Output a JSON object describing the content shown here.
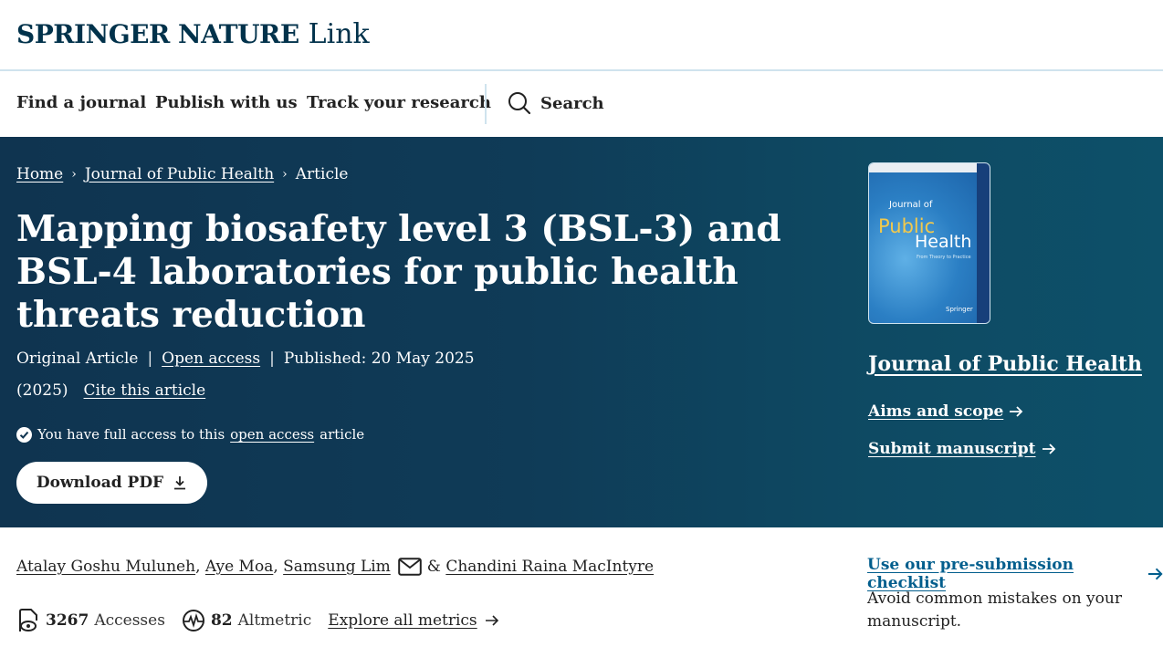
{
  "logo": {
    "brand": "SPRINGER NATURE",
    "product": "Link"
  },
  "nav": {
    "items": [
      "Find a journal",
      "Publish with us",
      "Track your research"
    ],
    "search_label": "Search"
  },
  "breadcrumb": {
    "home": "Home",
    "journal": "Journal of Public Health",
    "current": "Article",
    "separator": "›"
  },
  "article": {
    "title": "Mapping biosafety level 3 (BSL-3) and BSL-4 laboratories for public health threats reduction",
    "type": "Original Article",
    "access_label": "Open access",
    "published": "Published: 20 May 2025",
    "year": "(2025)",
    "cite_label": "Cite this article",
    "access_note_prefix": "You have full access to this",
    "access_note_link": "open access",
    "access_note_suffix": "article",
    "download_label": "Download PDF",
    "separator": "|"
  },
  "cover": {
    "line1": "Journal of",
    "line2": "Public",
    "line3": "Health",
    "subtitle": "From Theory to Practice",
    "publisher": "Springer"
  },
  "sidebar": {
    "journal_title": "Journal of Public Health",
    "aims_label": "Aims and scope",
    "submit_label": "Submit manuscript",
    "checklist_label": "Use our pre-submission checklist",
    "checklist_note": "Avoid common mistakes on your manuscript."
  },
  "authors": {
    "list": [
      "Atalay Goshu Muluneh",
      "Aye Moa",
      "Samsung Lim",
      "Chandini Raina MacIntyre"
    ],
    "comma": ",",
    "ampersand": "&"
  },
  "metrics": {
    "accesses_value": "3267",
    "accesses_label": "Accesses",
    "altmetric_value": "82",
    "altmetric_label": "Altmetric",
    "explore_label": "Explore all metrics"
  },
  "colors": {
    "hero_bg": "#0f3450",
    "brand": "#01324b",
    "link_blue": "#025e8d"
  },
  "icons": [
    "search-icon",
    "chevron-right-icon",
    "check-circle-icon",
    "download-icon",
    "arrow-right-icon",
    "mail-icon",
    "accesses-icon",
    "altmetric-icon"
  ]
}
